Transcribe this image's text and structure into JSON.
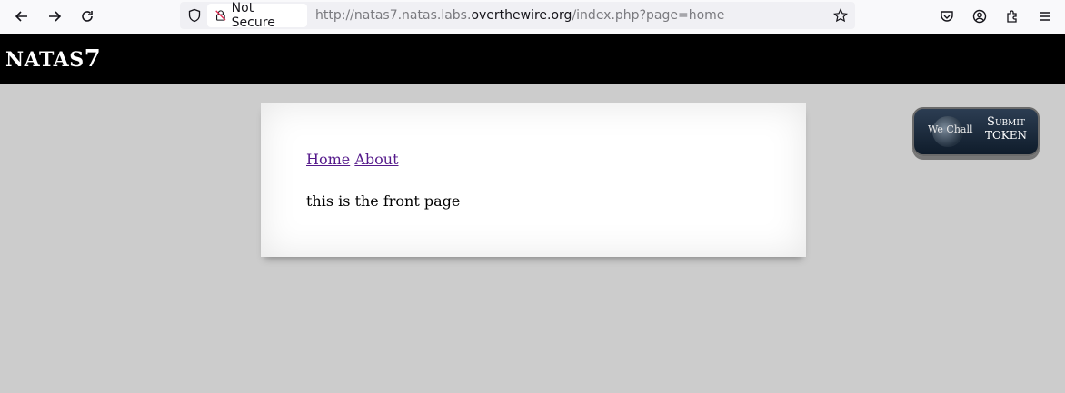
{
  "browser": {
    "security_label": "Not Secure",
    "url_prefix": "http://natas7.natas.labs.",
    "url_domain": "overthewire.org",
    "url_suffix": "/index.php?page=home"
  },
  "header": {
    "title_big": "NATAS",
    "title_num": "7"
  },
  "nav": {
    "home": "Home",
    "about": "About"
  },
  "content": {
    "text": "this is the front page"
  },
  "wechall": {
    "logo": "We Chall",
    "submit_line1": "Submit",
    "submit_line2": "Token"
  }
}
